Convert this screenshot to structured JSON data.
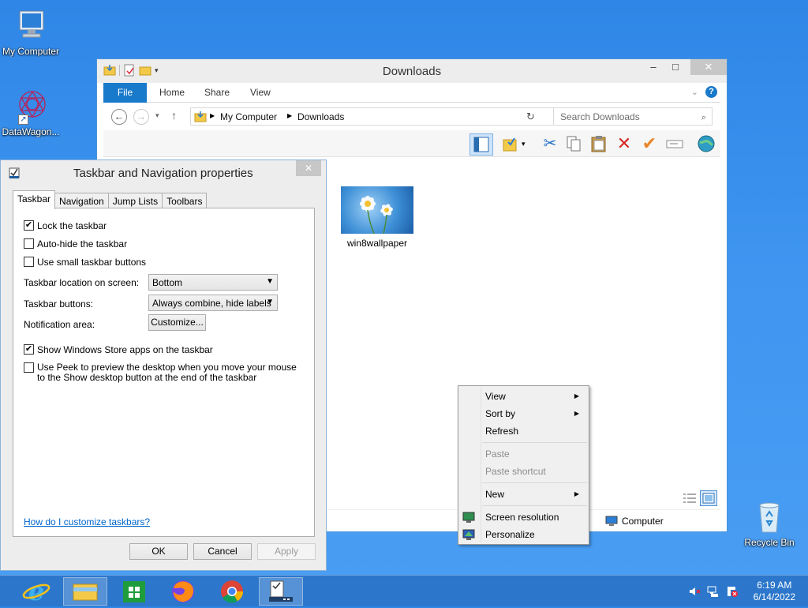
{
  "desktop": {
    "icons": [
      {
        "label": "My Computer"
      },
      {
        "label": "DataWagon..."
      },
      {
        "label": "Recycle Bin"
      }
    ]
  },
  "explorer": {
    "title": "Downloads",
    "ribbon_tabs": [
      "File",
      "Home",
      "Share",
      "View"
    ],
    "breadcrumb": [
      "My Computer",
      "Downloads"
    ],
    "search_placeholder": "Search Downloads",
    "files": [
      {
        "name": "win8wallpaper"
      }
    ],
    "status_location": "Computer"
  },
  "dialog": {
    "title": "Taskbar and Navigation properties",
    "tabs": [
      "Taskbar",
      "Navigation",
      "Jump Lists",
      "Toolbars"
    ],
    "active_tab": "Taskbar",
    "options": {
      "lock_taskbar": {
        "label": "Lock the taskbar",
        "checked": true
      },
      "auto_hide": {
        "label": "Auto-hide the taskbar",
        "checked": false
      },
      "small_buttons": {
        "label": "Use small taskbar buttons",
        "checked": false
      },
      "store_apps": {
        "label": "Show Windows Store apps on the taskbar",
        "checked": true
      },
      "peek": {
        "label": "Use Peek to preview the desktop when you move your mouse to the Show desktop button at the end of the taskbar",
        "checked": false
      }
    },
    "location_label": "Taskbar location on screen:",
    "location_value": "Bottom",
    "buttons_label": "Taskbar buttons:",
    "buttons_value": "Always combine, hide labels",
    "notification_label": "Notification area:",
    "customize_button": "Customize...",
    "help_link": "How do I customize taskbars?",
    "ok": "OK",
    "cancel": "Cancel",
    "apply": "Apply",
    "check_mark": "✔"
  },
  "context_menu": {
    "items": [
      {
        "label": "View",
        "submenu": true,
        "enabled": true
      },
      {
        "label": "Sort by",
        "submenu": true,
        "enabled": true
      },
      {
        "label": "Refresh",
        "submenu": false,
        "enabled": true
      },
      {
        "label": "Paste",
        "submenu": false,
        "enabled": false
      },
      {
        "label": "Paste shortcut",
        "submenu": false,
        "enabled": false
      },
      {
        "label": "New",
        "submenu": true,
        "enabled": true
      },
      {
        "label": "Screen resolution",
        "submenu": false,
        "enabled": true
      },
      {
        "label": "Personalize",
        "submenu": false,
        "enabled": true
      }
    ]
  },
  "taskbar": {
    "apps": [
      {
        "icon": "internet-explorer-icon",
        "running": false
      },
      {
        "icon": "file-explorer-icon",
        "running": true
      },
      {
        "icon": "store-icon",
        "running": false
      },
      {
        "icon": "firefox-icon",
        "running": false
      },
      {
        "icon": "chrome-icon",
        "running": false
      },
      {
        "icon": "taskbar-properties-icon",
        "running": true
      }
    ],
    "time": "6:19 AM",
    "date": "6/14/2022"
  },
  "colors": {
    "accent": "#1979ca",
    "desktop": "#3f95f0"
  }
}
